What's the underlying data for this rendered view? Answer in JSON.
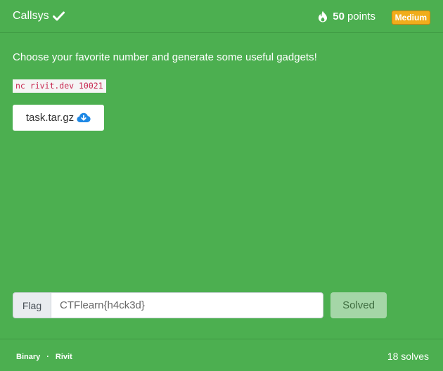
{
  "header": {
    "title": "Callsys",
    "points_value": "50",
    "points_label": "points",
    "difficulty": "Medium",
    "check_icon": "check-icon",
    "flame_icon": "flame-icon"
  },
  "description": "Choose your favorite number and generate some useful gadgets!",
  "connection": "nc rivit.dev 10021",
  "file": {
    "name": "task.tar.gz",
    "icon": "cloud-download-icon"
  },
  "flag": {
    "label": "Flag",
    "value": "CTFlearn{h4ck3d}",
    "button": "Solved"
  },
  "footer": {
    "category": "Binary",
    "separator": "·",
    "author": "Rivit",
    "solves": "18 solves"
  },
  "colors": {
    "background": "#4caf50",
    "badge": "#f0ad1b",
    "solved_button": "#a5d6a7",
    "code_text": "#c7254e",
    "download_icon": "#1e88e5"
  }
}
